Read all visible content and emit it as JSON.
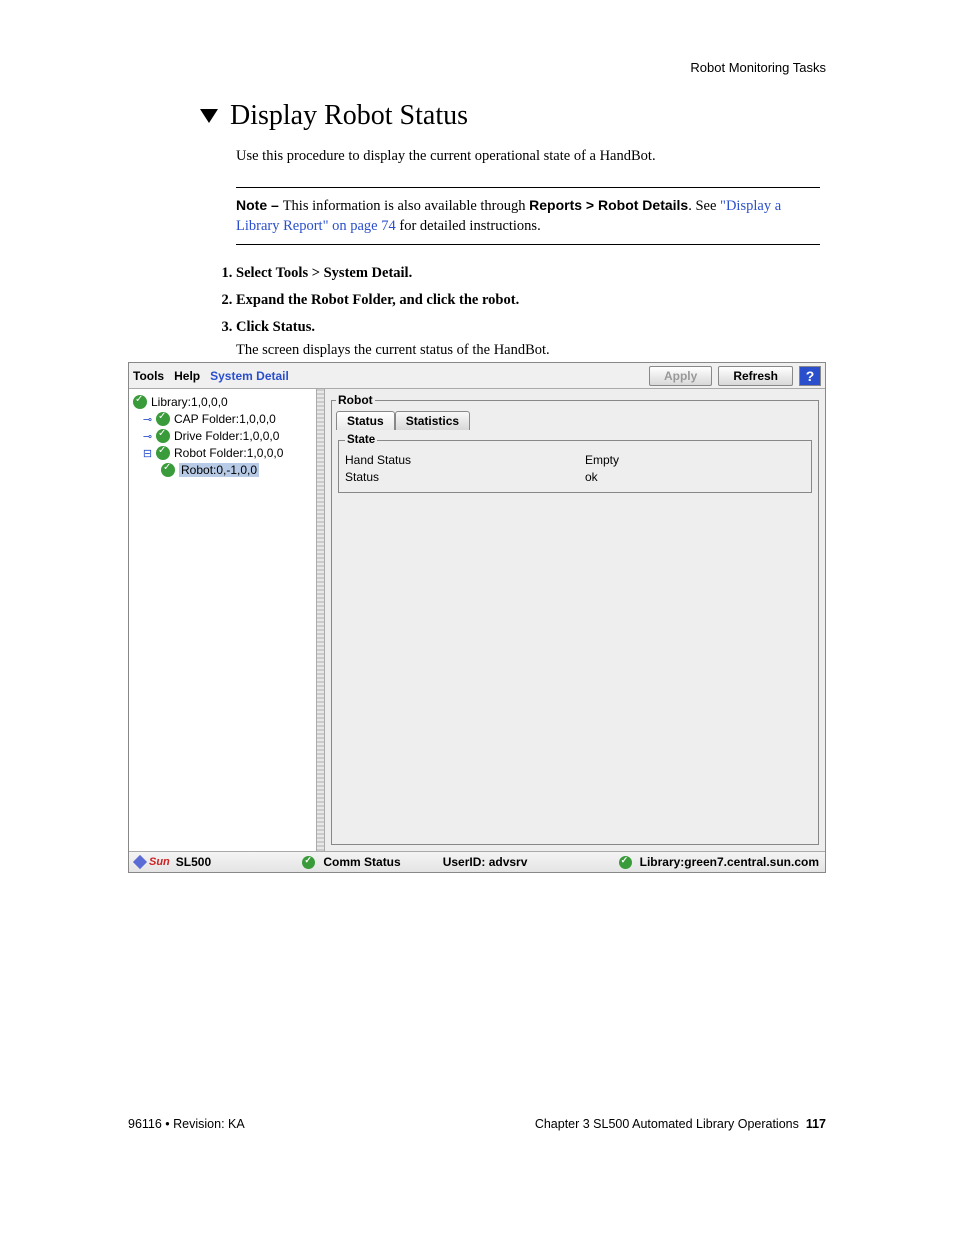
{
  "header": {
    "section_title": "Robot Monitoring Tasks"
  },
  "title": "Display Robot Status",
  "intro": "Use this procedure to display the current operational state of a HandBot.",
  "note": {
    "prefix": "Note – ",
    "text_before_bold": "This information is also available through ",
    "bold_path": "Reports > Robot Details",
    "after_bold": ". See ",
    "link": "\"Display a Library Report\" on page 74",
    "after_link": " for detailed instructions."
  },
  "steps": [
    {
      "text": "Select Tools > System Detail."
    },
    {
      "text": "Expand the Robot Folder, and click the robot."
    },
    {
      "text": "Click Status.",
      "desc": "The screen displays the current status of the HandBot."
    }
  ],
  "app": {
    "menu": {
      "tools": "Tools",
      "help": "Help",
      "system_detail": "System Detail"
    },
    "buttons": {
      "apply": "Apply",
      "refresh": "Refresh",
      "help": "?"
    },
    "tree": {
      "library": "Library:1,0,0,0",
      "cap": "CAP Folder:1,0,0,0",
      "drive": "Drive Folder:1,0,0,0",
      "robot_folder": "Robot Folder:1,0,0,0",
      "robot": "Robot:0,-1,0,0"
    },
    "panel": {
      "legend": "Robot",
      "tabs": {
        "status": "Status",
        "statistics": "Statistics"
      },
      "state_legend": "State",
      "rows": [
        {
          "k": "Hand Status",
          "v": "Empty"
        },
        {
          "k": "Status",
          "v": "ok"
        }
      ]
    },
    "statusbar": {
      "sun": "Sun",
      "model": "SL500",
      "comm": "Comm Status",
      "userid_label": "UserID: ",
      "userid": "advsrv",
      "library_label": "Library:",
      "library_host": "green7.central.sun.com"
    }
  },
  "footer": {
    "left": "96116 • Revision: KA",
    "right_prefix": "Chapter 3 SL500 Automated Library Operations",
    "page": "117"
  }
}
